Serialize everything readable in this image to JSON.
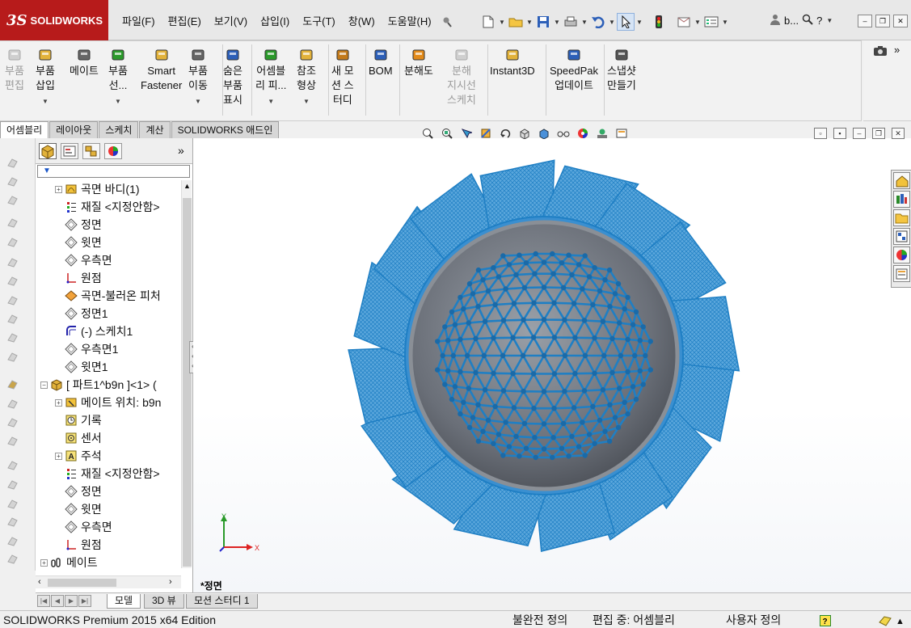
{
  "app": {
    "logo_mark": "3S",
    "logo_text": "SOLIDWORKS",
    "brand_color": "#b71b1b"
  },
  "menu": [
    "파일(F)",
    "편집(E)",
    "보기(V)",
    "삽입(I)",
    "도구(T)",
    "창(W)",
    "도움말(H)"
  ],
  "toolbar": {
    "icons": [
      "pin-icon",
      "new-document-icon",
      "open-icon",
      "save-icon",
      "print-icon",
      "undo-icon",
      "select-icon",
      "rebuild-icon",
      "file-properties-icon",
      "options-icon"
    ],
    "search_short": "b..."
  },
  "ribbon": {
    "buttons": [
      {
        "label": "부품\n편집",
        "icon": "edit-component-icon",
        "enabled": false
      },
      {
        "label": "부품\n삽입",
        "icon": "insert-component-icon",
        "enabled": true
      },
      {
        "label": "메이트",
        "icon": "mate-icon",
        "enabled": true
      },
      {
        "label": "부품\n선...",
        "icon": "linear-pattern-icon",
        "enabled": true
      },
      {
        "label": "Smart\nFastener",
        "icon": "smart-fastener-icon",
        "enabled": true
      },
      {
        "label": "부품\n이동",
        "icon": "move-component-icon",
        "enabled": true
      },
      {
        "label": "숨은\n부품\n표시",
        "icon": "show-hidden-icon",
        "enabled": true
      },
      {
        "label": "어셈블\n리 피...",
        "icon": "assembly-feature-icon",
        "enabled": true
      },
      {
        "label": "참조\n형상",
        "icon": "reference-geometry-icon",
        "enabled": true
      },
      {
        "label": "새 모\n션 스\n터디",
        "icon": "motion-study-icon",
        "enabled": true
      },
      {
        "label": "BOM",
        "icon": "bom-icon",
        "enabled": true
      },
      {
        "label": "분해도",
        "icon": "exploded-view-icon",
        "enabled": true
      },
      {
        "label": "분해\n지시선\n스케치",
        "icon": "explode-line-icon",
        "enabled": false
      },
      {
        "label": "Instant3D",
        "icon": "instant3d-icon",
        "enabled": true
      },
      {
        "label": "SpeedPak\n업데이트",
        "icon": "speedpak-icon",
        "enabled": true
      },
      {
        "label": "스냅샷\n만들기",
        "icon": "snapshot-icon",
        "enabled": true
      }
    ]
  },
  "command_tabs": [
    "어셈블리",
    "레이아웃",
    "스케치",
    "계산",
    "SOLIDWORKS 애드인"
  ],
  "active_command_tab": "어셈블리",
  "feature_tree": {
    "items": [
      {
        "label": "곡면 바디(1)",
        "icon": "surface-body-icon",
        "expand": "+",
        "indent": 1
      },
      {
        "label": "재질 <지정안함>",
        "icon": "material-icon",
        "expand": "",
        "indent": 1
      },
      {
        "label": "정면",
        "icon": "plane-icon",
        "expand": "",
        "indent": 1
      },
      {
        "label": "윗면",
        "icon": "plane-icon",
        "expand": "",
        "indent": 1
      },
      {
        "label": "우측면",
        "icon": "plane-icon",
        "expand": "",
        "indent": 1
      },
      {
        "label": "원점",
        "icon": "origin-icon",
        "expand": "",
        "indent": 1
      },
      {
        "label": "곡면-불러온 피처",
        "icon": "imported-surface-icon",
        "expand": "",
        "indent": 1
      },
      {
        "label": "정면1",
        "icon": "plane-icon",
        "expand": "",
        "indent": 1
      },
      {
        "label": "(-) 스케치1",
        "icon": "sketch-icon",
        "expand": "",
        "indent": 1
      },
      {
        "label": "우측면1",
        "icon": "plane-icon",
        "expand": "",
        "indent": 1
      },
      {
        "label": "윗면1",
        "icon": "plane-icon",
        "expand": "",
        "indent": 1
      },
      {
        "label": "[ 파트1^b9n ]<1> (",
        "icon": "part-icon",
        "expand": "−",
        "indent": 0
      },
      {
        "label": "메이트 위치: b9n",
        "icon": "mates-in-icon",
        "expand": "+",
        "indent": 1
      },
      {
        "label": "기록",
        "icon": "history-icon",
        "expand": "",
        "indent": 1
      },
      {
        "label": "센서",
        "icon": "sensor-icon",
        "expand": "",
        "indent": 1
      },
      {
        "label": "주석",
        "icon": "annotation-icon",
        "expand": "+",
        "indent": 1
      },
      {
        "label": "재질 <지정안함>",
        "icon": "material-icon",
        "expand": "",
        "indent": 1
      },
      {
        "label": "정면",
        "icon": "plane-icon",
        "expand": "",
        "indent": 1
      },
      {
        "label": "윗면",
        "icon": "plane-icon",
        "expand": "",
        "indent": 1
      },
      {
        "label": "우측면",
        "icon": "plane-icon",
        "expand": "",
        "indent": 1
      },
      {
        "label": "원점",
        "icon": "origin-icon",
        "expand": "",
        "indent": 1
      },
      {
        "label": "메이트",
        "icon": "mates-icon",
        "expand": "+",
        "indent": 0
      }
    ]
  },
  "viewport": {
    "view_label": "*정면",
    "axis": {
      "y_label": "Y",
      "x_label": "X"
    },
    "model_color": "#1f7fc4",
    "sphere_color": "#6a6f78"
  },
  "bottom_tabs": [
    "모델",
    "3D 뷰",
    "모션 스터디 1"
  ],
  "active_bottom_tab": "모델",
  "status": {
    "edition": "SOLIDWORKS Premium 2015 x64 Edition",
    "definition": "불완전 정의",
    "editing": "편집 중: 어셈블리",
    "custom": "사용자 정의"
  }
}
